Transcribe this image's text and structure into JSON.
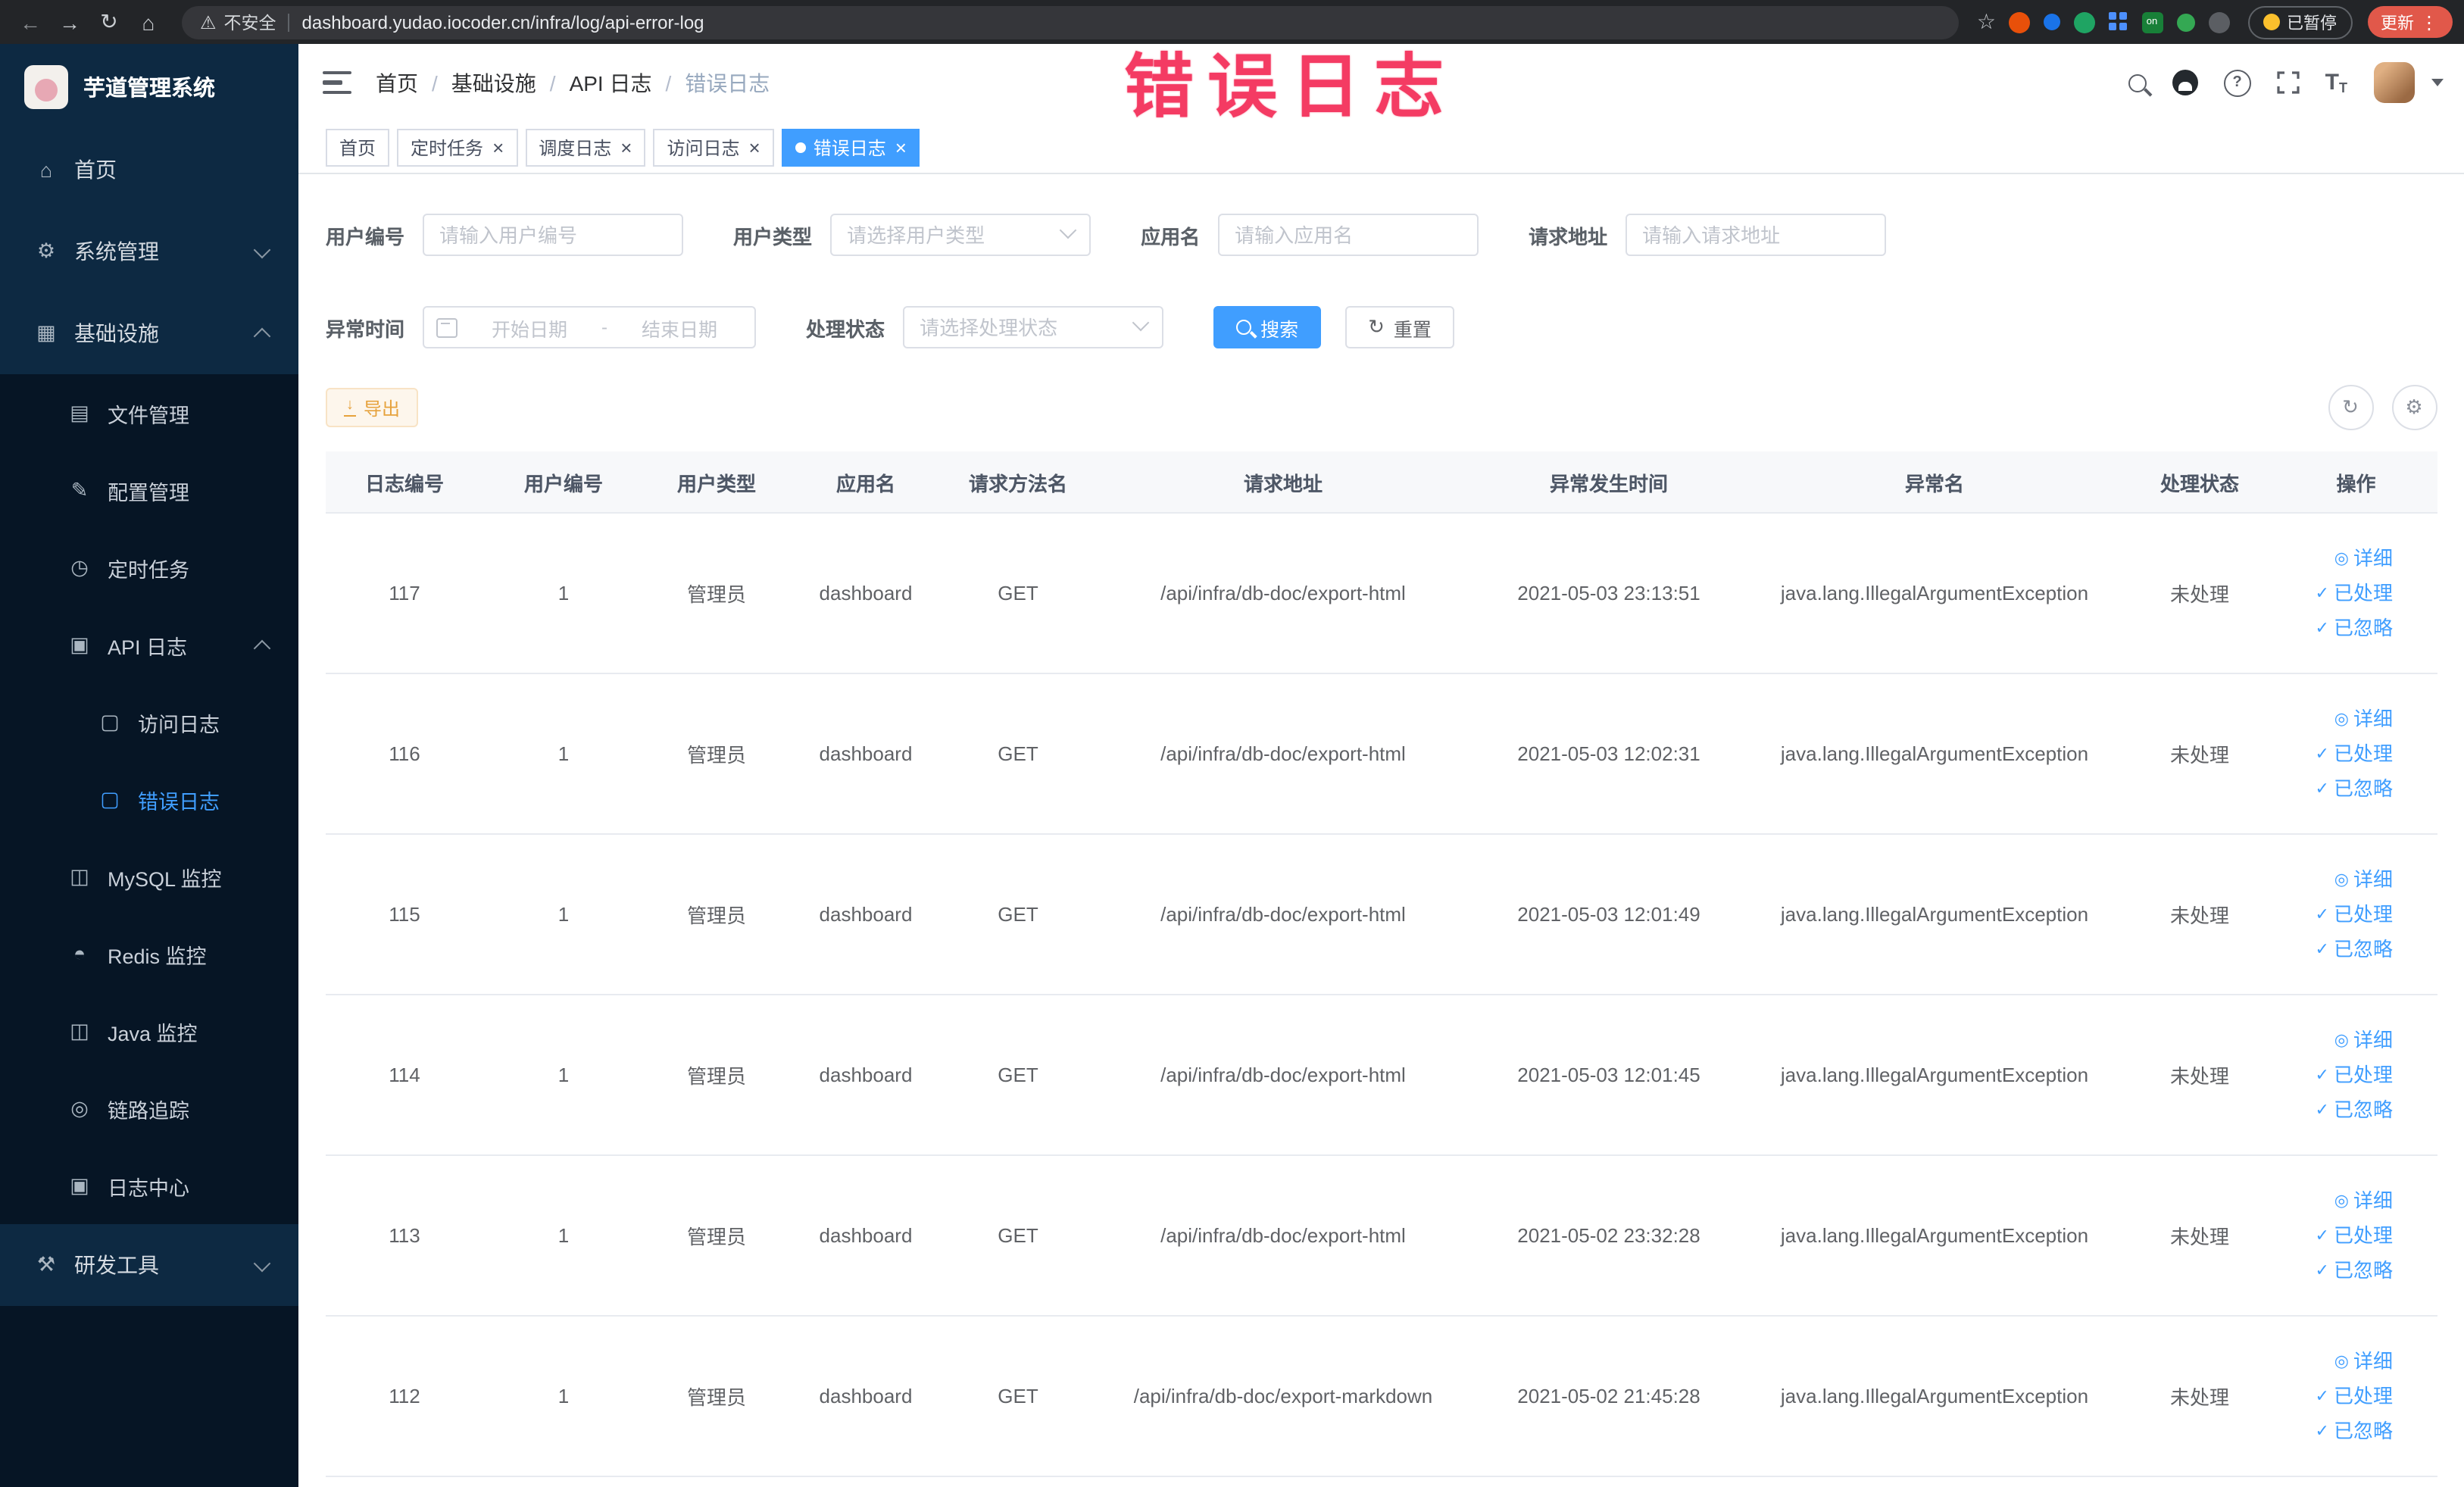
{
  "browser": {
    "security_label": "不安全",
    "url": "dashboard.yudao.iocoder.cn/infra/log/api-error-log",
    "paused_label": "已暂停",
    "update_label": "更新",
    "extension_on_label": "on"
  },
  "annotation": {
    "text": "错误日志"
  },
  "icons": {
    "back": "←",
    "forward": "→",
    "reload": "↻",
    "home_nav": "⌂",
    "warning": "⚠",
    "star": "☆",
    "kebab": "⋮",
    "close": "×",
    "check": "✓",
    "eye": "◎",
    "refresh": "↻",
    "question": "?",
    "font_t": "T",
    "download": "↓",
    "home": "⌂",
    "gear": "⚙",
    "grid": "▦",
    "file": "▤",
    "edit": "✎",
    "timer": "◷",
    "log": "▣",
    "doc": "▢",
    "monitor": "◫",
    "db": "◓",
    "trace": "◎",
    "tools": "⚒"
  },
  "sidebar": {
    "app_title": "芋道管理系统",
    "items": [
      {
        "key": "home",
        "label": "首页",
        "icon": "home",
        "level": 0,
        "sub": false
      },
      {
        "key": "system",
        "label": "系统管理",
        "icon": "gear",
        "level": 0,
        "sub": false,
        "chevron": "down"
      },
      {
        "key": "infra",
        "label": "基础设施",
        "icon": "grid",
        "level": 0,
        "sub": false,
        "chevron": "up"
      },
      {
        "key": "file",
        "label": "文件管理",
        "icon": "file",
        "level": 1,
        "sub": true
      },
      {
        "key": "config",
        "label": "配置管理",
        "icon": "edit",
        "level": 1,
        "sub": true
      },
      {
        "key": "job",
        "label": "定时任务",
        "icon": "timer",
        "level": 1,
        "sub": true
      },
      {
        "key": "api-log",
        "label": "API 日志",
        "icon": "log",
        "level": 1,
        "sub": true,
        "chevron": "up"
      },
      {
        "key": "access-log",
        "label": "访问日志",
        "icon": "doc",
        "level": 2,
        "sub": true
      },
      {
        "key": "error-log",
        "label": "错误日志",
        "icon": "doc",
        "level": 2,
        "sub": true,
        "active": true
      },
      {
        "key": "mysql",
        "label": "MySQL 监控",
        "icon": "monitor",
        "level": 1,
        "sub": true
      },
      {
        "key": "redis",
        "label": "Redis 监控",
        "icon": "db",
        "level": 1,
        "sub": true
      },
      {
        "key": "java",
        "label": "Java 监控",
        "icon": "monitor",
        "level": 1,
        "sub": true
      },
      {
        "key": "trace",
        "label": "链路追踪",
        "icon": "trace",
        "level": 1,
        "sub": true
      },
      {
        "key": "log-center",
        "label": "日志中心",
        "icon": "log",
        "level": 1,
        "sub": true
      },
      {
        "key": "devtools",
        "label": "研发工具",
        "icon": "tools",
        "level": 0,
        "sub": false,
        "chevron": "down"
      }
    ]
  },
  "header": {
    "breadcrumbs": [
      "首页",
      "基础设施",
      "API 日志",
      "错误日志"
    ],
    "separator": "/"
  },
  "tabs": [
    {
      "key": "home",
      "label": "首页",
      "closable": false,
      "active": false
    },
    {
      "key": "job",
      "label": "定时任务",
      "closable": true,
      "active": false
    },
    {
      "key": "job-log",
      "label": "调度日志",
      "closable": true,
      "active": false
    },
    {
      "key": "access-log",
      "label": "访问日志",
      "closable": true,
      "active": false
    },
    {
      "key": "error-log",
      "label": "错误日志",
      "closable": true,
      "active": true
    }
  ],
  "filters": {
    "user_id": {
      "label": "用户编号",
      "placeholder": "请输入用户编号"
    },
    "user_type": {
      "label": "用户类型",
      "placeholder": "请选择用户类型"
    },
    "app_name": {
      "label": "应用名",
      "placeholder": "请输入应用名"
    },
    "request_url": {
      "label": "请求地址",
      "placeholder": "请输入请求地址"
    },
    "exception_time": {
      "label": "异常时间",
      "start_placeholder": "开始日期",
      "separator": "-",
      "end_placeholder": "结束日期"
    },
    "process_status": {
      "label": "处理状态",
      "placeholder": "请选择处理状态"
    },
    "search_button": "搜索",
    "reset_button": "重置"
  },
  "toolbar": {
    "export_button": "导出"
  },
  "table": {
    "columns": [
      "日志编号",
      "用户编号",
      "用户类型",
      "应用名",
      "请求方法名",
      "请求地址",
      "异常发生时间",
      "异常名",
      "处理状态",
      "操作"
    ],
    "row_keys": [
      "id",
      "user_id",
      "user_type",
      "app",
      "method",
      "url",
      "time",
      "exception",
      "status"
    ],
    "actions": [
      {
        "key": "detail",
        "label": "详细",
        "icon": "eye"
      },
      {
        "key": "processed",
        "label": "已处理",
        "icon": "check"
      },
      {
        "key": "ignored",
        "label": "已忽略",
        "icon": "check"
      }
    ],
    "rows": [
      {
        "id": "117",
        "user_id": "1",
        "user_type": "管理员",
        "app": "dashboard",
        "method": "GET",
        "url": "/api/infra/db-doc/export-html",
        "time": "2021-05-03 23:13:51",
        "exception": "java.lang.IllegalArgumentException",
        "status": "未处理"
      },
      {
        "id": "116",
        "user_id": "1",
        "user_type": "管理员",
        "app": "dashboard",
        "method": "GET",
        "url": "/api/infra/db-doc/export-html",
        "time": "2021-05-03 12:02:31",
        "exception": "java.lang.IllegalArgumentException",
        "status": "未处理"
      },
      {
        "id": "115",
        "user_id": "1",
        "user_type": "管理员",
        "app": "dashboard",
        "method": "GET",
        "url": "/api/infra/db-doc/export-html",
        "time": "2021-05-03 12:01:49",
        "exception": "java.lang.IllegalArgumentException",
        "status": "未处理"
      },
      {
        "id": "114",
        "user_id": "1",
        "user_type": "管理员",
        "app": "dashboard",
        "method": "GET",
        "url": "/api/infra/db-doc/export-html",
        "time": "2021-05-03 12:01:45",
        "exception": "java.lang.IllegalArgumentException",
        "status": "未处理"
      },
      {
        "id": "113",
        "user_id": "1",
        "user_type": "管理员",
        "app": "dashboard",
        "method": "GET",
        "url": "/api/infra/db-doc/export-html",
        "time": "2021-05-02 23:32:28",
        "exception": "java.lang.IllegalArgumentException",
        "status": "未处理"
      },
      {
        "id": "112",
        "user_id": "1",
        "user_type": "管理员",
        "app": "dashboard",
        "method": "GET",
        "url": "/api/infra/db-doc/export-markdown",
        "time": "2021-05-02 21:45:28",
        "exception": "java.lang.IllegalArgumentException",
        "status": "未处理"
      }
    ]
  }
}
